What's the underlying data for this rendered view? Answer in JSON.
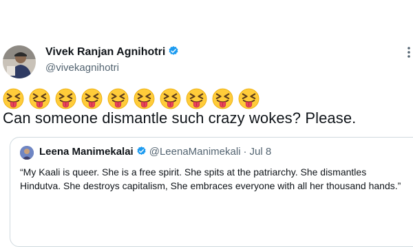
{
  "author": {
    "name": "Vivek Ranjan Agnihotri",
    "handle": "@vivekagnihotri",
    "avatar": "person-with-cap-photo",
    "verified": true
  },
  "tweet": {
    "emojis": [
      "😝",
      "😝",
      "😝",
      "😝",
      "😝",
      "😝",
      "😝",
      "😝",
      "😝",
      "😝"
    ],
    "emoji_name": "squinting-face-with-tongue",
    "text": "Can someone dismantle such crazy wokes? Please."
  },
  "quoted_tweet": {
    "author_name": "Leena Manimekalai",
    "handle": "@LeenaManimekali",
    "separator": "·",
    "date": "Jul 8",
    "verified": true,
    "text": "“My Kaali is queer. She is a free spirit. She spits at the patriarchy. She dismantles Hindutva. She destroys capitalism, She embraces everyone with all her thousand hands.”"
  },
  "colors": {
    "verified_blue": "#1d9bf0",
    "secondary_text": "#536471",
    "border": "#cfd9de",
    "emoji_yellow": "#ffcc3a"
  }
}
